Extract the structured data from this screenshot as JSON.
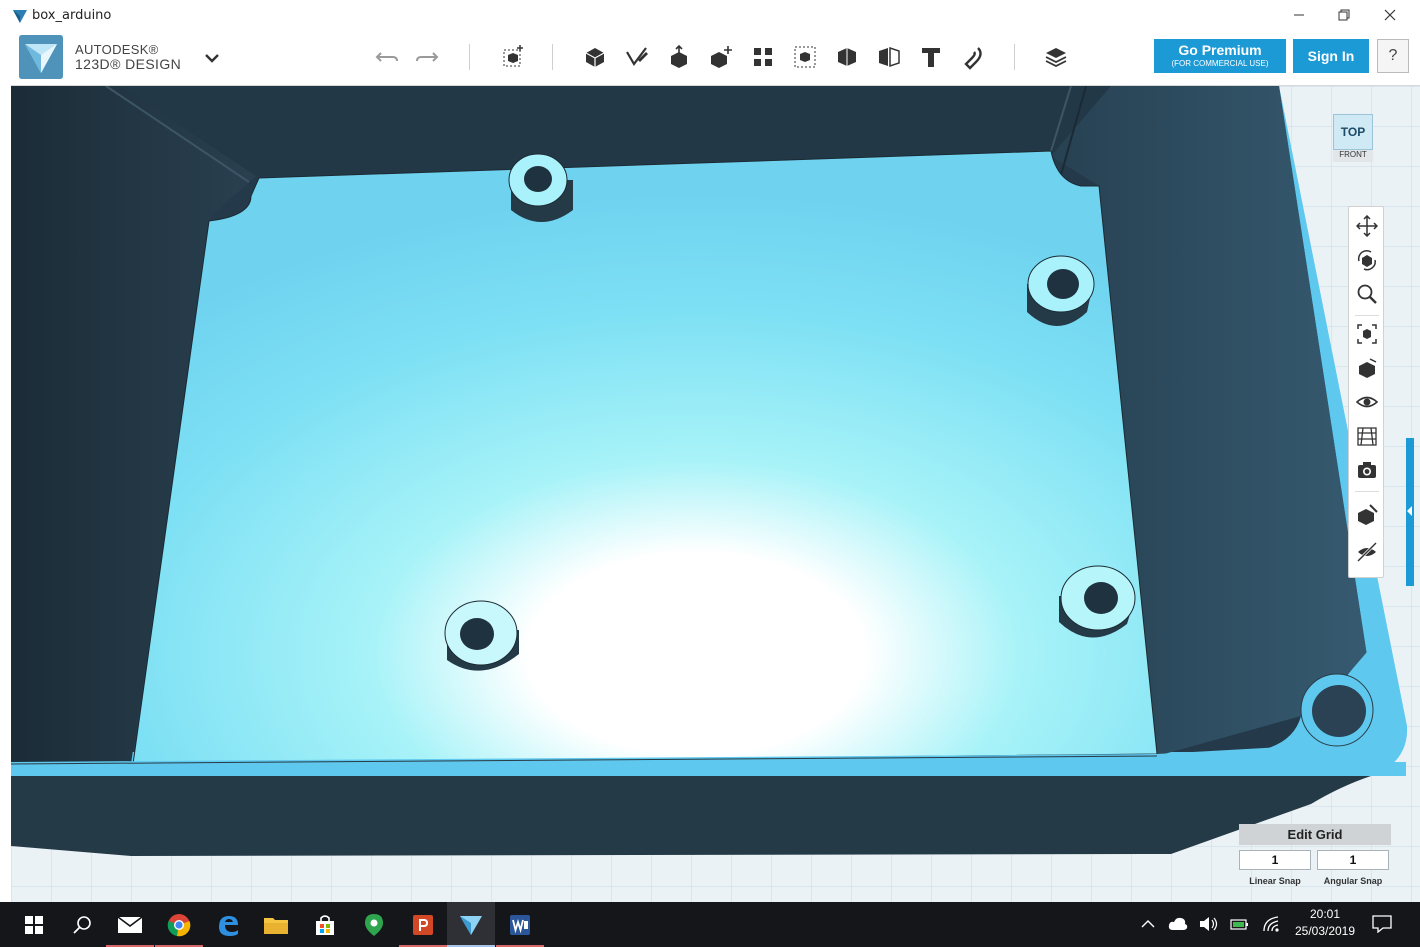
{
  "window": {
    "title": "box_arduino"
  },
  "brand": {
    "line1": "AUTODESK®",
    "line2": "123D® DESIGN"
  },
  "toolbar": {
    "premium_label": "Go Premium",
    "premium_sub": "(FOR COMMERCIAL USE)",
    "signin_label": "Sign In",
    "help_label": "?"
  },
  "viewcube": {
    "top_label": "TOP",
    "front_label": "FRONT"
  },
  "grid": {
    "title": "Edit Grid",
    "linear_snap_value": "1",
    "angular_snap_value": "1",
    "linear_snap_label": "Linear Snap",
    "angular_snap_label": "Angular Snap"
  },
  "clock": {
    "time": "20:01",
    "date": "25/03/2019"
  },
  "colors": {
    "accent": "#1c9ad6",
    "model_wall": "#253a47",
    "model_floor": "#7ad6f0",
    "model_rim": "#5ec8ef",
    "taskbar": "#15161a"
  },
  "icons": {
    "toolbar": [
      "undo-icon",
      "redo-icon",
      "transform-icon",
      "primitives-icon",
      "sketch-icon",
      "construct-icon",
      "modify-icon",
      "pattern-icon",
      "grouping-icon",
      "combine-icon",
      "measure-icon",
      "text-icon",
      "snap-icon",
      "materials-icon"
    ],
    "navbar": [
      "pan-icon",
      "orbit-icon",
      "zoom-icon",
      "fit-icon",
      "views-icon",
      "visibility-icon",
      "grid-icon",
      "screenshot-icon",
      "material-icon",
      "hide-icon"
    ]
  }
}
